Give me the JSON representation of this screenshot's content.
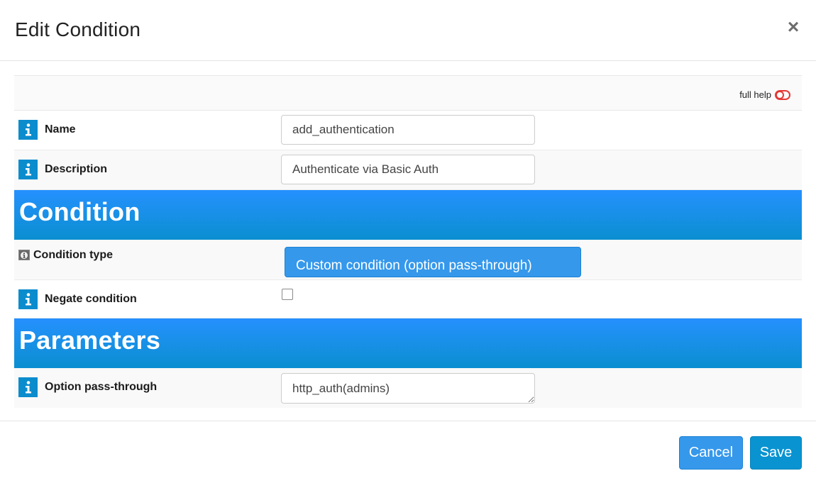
{
  "dialog": {
    "title": "Edit Condition",
    "close_icon": "close-icon"
  },
  "help": {
    "full_help_label": "full help",
    "toggle_icon": "toggle-off-icon",
    "toggle_color": "#e53935"
  },
  "fields": {
    "name": {
      "label": "Name",
      "value": "add_authentication",
      "icon": "info-icon"
    },
    "description": {
      "label": "Description",
      "value": "Authenticate via Basic Auth",
      "icon": "info-icon"
    }
  },
  "sections": {
    "condition": {
      "title": "Condition",
      "condition_type": {
        "label": "Condition type",
        "selected": "Custom condition (option pass-through)",
        "icon": "info-small-icon"
      },
      "negate": {
        "label": "Negate condition",
        "checked": false,
        "icon": "info-icon"
      }
    },
    "parameters": {
      "title": "Parameters",
      "option_pass_through": {
        "label": "Option pass-through",
        "value": "http_auth(admins)",
        "icon": "info-icon"
      }
    }
  },
  "footer": {
    "cancel_label": "Cancel",
    "save_label": "Save"
  },
  "colors": {
    "section_gradient_top": "#2590fe",
    "section_gradient_bottom": "#0b8fd0",
    "info_icon_bg": "#0b8ccd",
    "primary_button": "#3598eb",
    "save_button": "#0993d1"
  }
}
